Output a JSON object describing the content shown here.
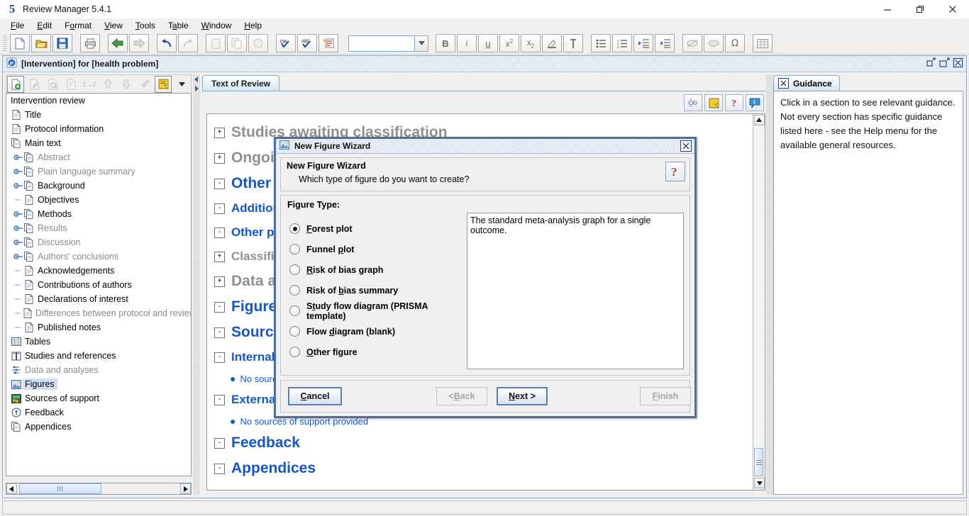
{
  "window": {
    "title": "Review Manager 5.4.1",
    "logo": "5",
    "controls": {
      "minimize": "minimize-icon",
      "restore": "restore-icon",
      "close": "close-icon"
    }
  },
  "menubar": [
    {
      "label": "File",
      "mnemonic": "F"
    },
    {
      "label": "Edit",
      "mnemonic": "E"
    },
    {
      "label": "Format",
      "mnemonic": "o"
    },
    {
      "label": "View",
      "mnemonic": "V"
    },
    {
      "label": "Tools",
      "mnemonic": "T"
    },
    {
      "label": "Table",
      "mnemonic": "a"
    },
    {
      "label": "Window",
      "mnemonic": "W"
    },
    {
      "label": "Help",
      "mnemonic": "H"
    }
  ],
  "main_toolbar": {
    "font_combo_value": "",
    "buttons": [
      "new-document-icon",
      "open-folder-icon",
      "save-disk-icon",
      "print-icon",
      "back-arrow-icon",
      "forward-arrow-icon",
      "undo-icon",
      "redo-icon",
      "cut-icon",
      "copy-icon",
      "paste-icon",
      "validate-ok-icon",
      "spellcheck-abc-icon",
      "highlight-changes-icon",
      "bold-icon",
      "italic-icon",
      "underline-icon",
      "superscript-icon",
      "subscript-icon",
      "text-highlight-icon",
      "pin-icon",
      "bullet-list-icon",
      "numbered-list-icon",
      "indent-increase-icon",
      "indent-decrease-icon",
      "link-icon",
      "link-break-icon",
      "omega-symbol-icon",
      "table-icon"
    ]
  },
  "mdi": {
    "title": "[Intervention] for [health problem]",
    "icon": "protocol-document-icon",
    "buttons": [
      "restore-window-icon",
      "maximize-window-icon",
      "close-window-icon"
    ]
  },
  "left_panel": {
    "toolbar_buttons": [
      "add-new-icon",
      "edit-icon",
      "preview-icon",
      "properties-icon",
      "renumber-icon",
      "move-up-icon",
      "move-down-icon",
      "link-study-icon",
      "notes-icon",
      "dropdown-arrow-icon"
    ],
    "tree": [
      {
        "label": "Intervention review",
        "level": 0,
        "icon": "none",
        "state": "normal",
        "knob": "none"
      },
      {
        "label": "Title",
        "level": 1,
        "icon": "page-icon",
        "state": "normal",
        "knob": "none"
      },
      {
        "label": "Protocol information",
        "level": 1,
        "icon": "page-icon",
        "state": "normal",
        "knob": "none"
      },
      {
        "label": "Main text",
        "level": 1,
        "icon": "pages-icon",
        "state": "normal",
        "knob": "none"
      },
      {
        "label": "Abstract",
        "level": 2,
        "icon": "pages-icon",
        "state": "dim",
        "knob": "collapsed"
      },
      {
        "label": "Plain language summary",
        "level": 2,
        "icon": "pages-icon",
        "state": "dim",
        "knob": "collapsed"
      },
      {
        "label": "Background",
        "level": 2,
        "icon": "pages-icon",
        "state": "normal",
        "knob": "collapsed"
      },
      {
        "label": "Objectives",
        "level": 2,
        "icon": "page-icon",
        "state": "normal",
        "knob": "leaf"
      },
      {
        "label": "Methods",
        "level": 2,
        "icon": "pages-icon",
        "state": "normal",
        "knob": "collapsed"
      },
      {
        "label": "Results",
        "level": 2,
        "icon": "pages-icon",
        "state": "dim",
        "knob": "collapsed"
      },
      {
        "label": "Discussion",
        "level": 2,
        "icon": "pages-icon",
        "state": "dim",
        "knob": "collapsed"
      },
      {
        "label": "Authors' conclusions",
        "level": 2,
        "icon": "pages-icon",
        "state": "dim",
        "knob": "collapsed"
      },
      {
        "label": "Acknowledgements",
        "level": 2,
        "icon": "page-icon",
        "state": "normal",
        "knob": "leaf"
      },
      {
        "label": "Contributions of authors",
        "level": 2,
        "icon": "page-icon",
        "state": "normal",
        "knob": "leaf"
      },
      {
        "label": "Declarations of interest",
        "level": 2,
        "icon": "page-icon",
        "state": "normal",
        "knob": "leaf"
      },
      {
        "label": "Differences between protocol and review",
        "level": 2,
        "icon": "page-icon",
        "state": "dim",
        "knob": "leaf"
      },
      {
        "label": "Published notes",
        "level": 2,
        "icon": "page-icon",
        "state": "normal",
        "knob": "leaf"
      },
      {
        "label": "Tables",
        "level": 1,
        "icon": "table-grid-icon",
        "state": "normal",
        "knob": "none"
      },
      {
        "label": "Studies and references",
        "level": 1,
        "icon": "book-icon",
        "state": "normal",
        "knob": "none"
      },
      {
        "label": "Data and analyses",
        "level": 1,
        "icon": "analysis-icon",
        "state": "dim",
        "knob": "none"
      },
      {
        "label": "Figures",
        "level": 1,
        "icon": "figure-image-icon",
        "state": "selected",
        "knob": "none"
      },
      {
        "label": "Sources of support",
        "level": 1,
        "icon": "money-icon",
        "state": "normal",
        "knob": "none"
      },
      {
        "label": "Feedback",
        "level": 1,
        "icon": "feedback-icon",
        "state": "normal",
        "knob": "none"
      },
      {
        "label": "Appendices",
        "level": 1,
        "icon": "pages-icon",
        "state": "normal",
        "knob": "none"
      }
    ],
    "hscrollbar": {
      "left_arrow": "arrow-left-icon",
      "right_arrow": "arrow-right-icon"
    }
  },
  "center_panel": {
    "tab": "Text of Review",
    "toolbar_buttons": [
      "settings-gear-icon",
      "notes-yellow-icon",
      "help-question-icon",
      "info-bubble-icon"
    ],
    "document": [
      {
        "text": "Studies awaiting classification",
        "style": "h1",
        "color": "grey",
        "expander": "+",
        "indent": 0
      },
      {
        "text": "Ongoing studies",
        "style": "h1",
        "color": "grey",
        "expander": "+",
        "indent": 0
      },
      {
        "text": "Other references",
        "style": "h1",
        "color": "blue",
        "expander": "-",
        "indent": 0
      },
      {
        "text": "Additional references",
        "style": "h2",
        "color": "blue",
        "expander": "-",
        "indent": 0
      },
      {
        "text": "Other published versions of this review",
        "style": "h2",
        "color": "blue",
        "expander": "-",
        "indent": 0
      },
      {
        "text": "Classification pending references",
        "style": "h2",
        "color": "grey",
        "expander": "+",
        "indent": 0
      },
      {
        "text": "Data and analyses",
        "style": "h1",
        "color": "grey",
        "expander": "+",
        "indent": 0
      },
      {
        "text": "Figures",
        "style": "h1",
        "color": "blue",
        "expander": "-",
        "indent": 0
      },
      {
        "text": "Sources of support",
        "style": "h1",
        "color": "blue",
        "expander": "-",
        "indent": 0
      },
      {
        "text": "Internal sources",
        "style": "h2",
        "color": "blue",
        "expander": "-",
        "indent": 0
      },
      {
        "text": "No sources of support provided",
        "style": "item",
        "color": "blue",
        "expander": "",
        "indent": 1
      },
      {
        "text": "External sources",
        "style": "h2",
        "color": "blue",
        "expander": "-",
        "indent": 0
      },
      {
        "text": "No sources of support provided",
        "style": "item",
        "color": "blue",
        "expander": "",
        "indent": 1
      },
      {
        "text": "Feedback",
        "style": "h1",
        "color": "blue",
        "expander": "-",
        "indent": 0
      },
      {
        "text": "Appendices",
        "style": "h1",
        "color": "blue",
        "expander": "-",
        "indent": 0
      }
    ],
    "vscrollbar": {
      "up_arrow": "arrow-up-icon",
      "down_arrow": "arrow-down-icon"
    }
  },
  "right_panel": {
    "tab": "Guidance",
    "tab_close": "close-x-icon",
    "body": "Click in a section to see relevant guidance. Not every section has specific guidance listed here - see the Help menu for the available general resources."
  },
  "dialog": {
    "title": "New Figure Wizard",
    "icon": "figure-image-icon",
    "close": "close-x-icon",
    "header_title": "New Figure Wizard",
    "header_subtitle": "Which type of figure do you want to create?",
    "help_button": "help-question-icon",
    "group_label": "Figure Type:",
    "options": [
      {
        "label": "Forest plot",
        "mnemonic": "F",
        "selected": true
      },
      {
        "label": "Funnel plot",
        "mnemonic": "p",
        "selected": false
      },
      {
        "label": "Risk of bias graph",
        "mnemonic": "R",
        "selected": false
      },
      {
        "label": "Risk of bias summary",
        "mnemonic": "b",
        "selected": false
      },
      {
        "label": "Study flow diagram (PRISMA template)",
        "mnemonic": "t",
        "selected": false
      },
      {
        "label": "Flow diagram (blank)",
        "mnemonic": "d",
        "selected": false
      },
      {
        "label": "Other figure",
        "mnemonic": "O",
        "selected": false
      }
    ],
    "description": "The standard meta-analysis graph for a single outcome.",
    "buttons": [
      {
        "label": "Cancel",
        "state": "default"
      },
      {
        "label": "< Back",
        "state": "disabled"
      },
      {
        "label": "Next >",
        "state": "primary"
      },
      {
        "label": "Finish",
        "state": "disabled"
      }
    ]
  },
  "colors": {
    "heading_blue": "#1457c8",
    "heading_grey": "#8f8f8f",
    "selection_blue": "#cfe0f3",
    "dialog_border": "#4a6fa5"
  }
}
